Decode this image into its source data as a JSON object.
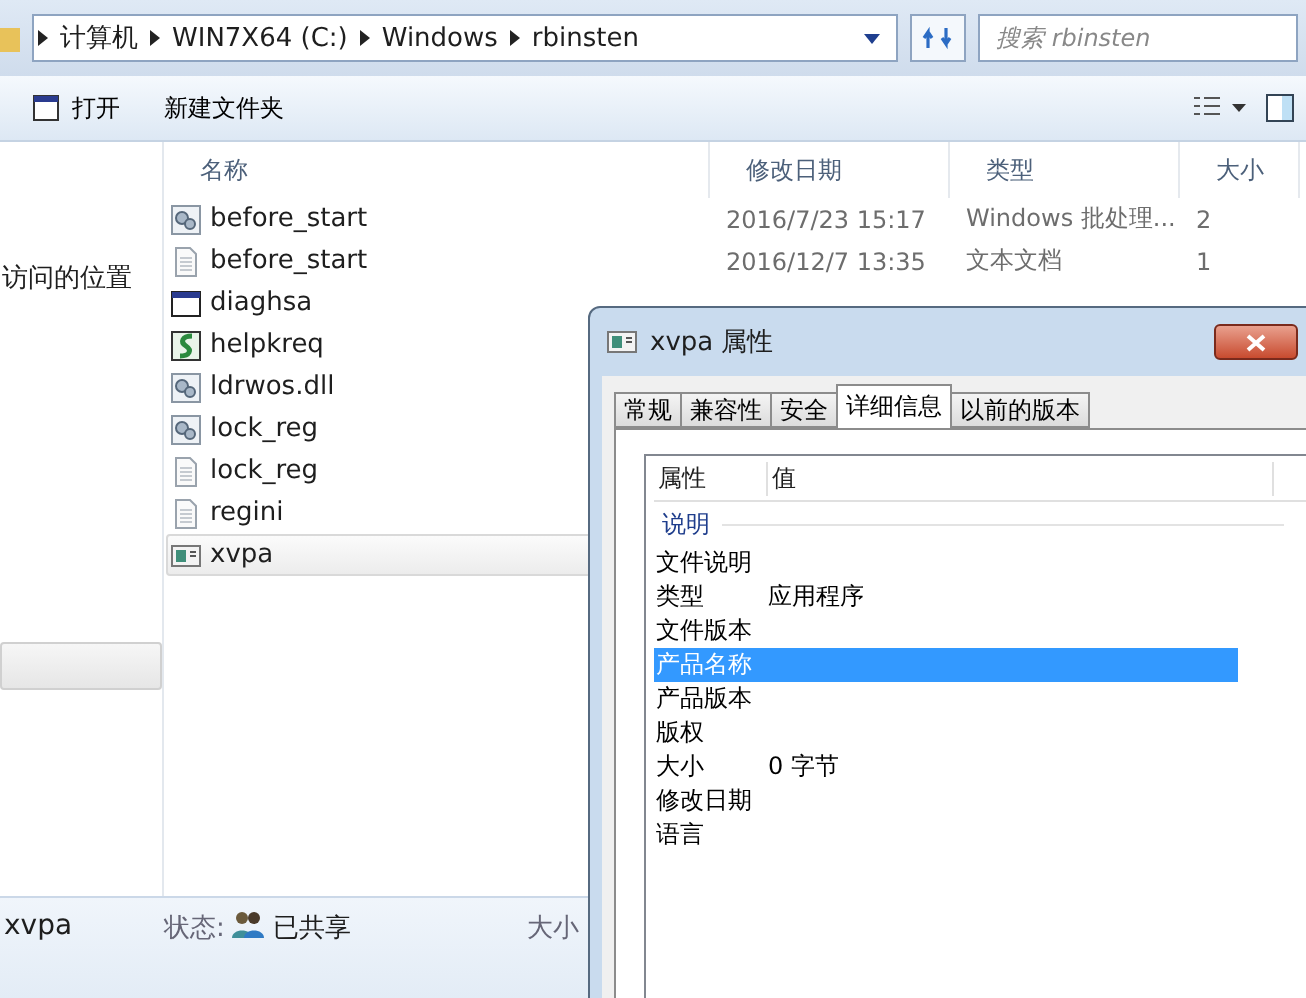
{
  "address_bar": {
    "crumbs": [
      "计算机",
      "WIN7X64 (C:)",
      "Windows",
      "rbinsten"
    ]
  },
  "search": {
    "placeholder": "搜索 rbinsten"
  },
  "toolbar": {
    "buttons": [
      "打开",
      "新建文件夹"
    ]
  },
  "sidebar": {
    "items": [
      {
        "label": "访问的位置",
        "selected": false
      },
      {
        "selected": true
      }
    ]
  },
  "file_list": {
    "columns": [
      "名称",
      "修改日期",
      "类型",
      "大小"
    ],
    "rows": [
      {
        "name": "before_start",
        "kind": "gear",
        "date": "2016/7/23 15:17",
        "type": "Windows 批处理...",
        "size": "2",
        "selected": false
      },
      {
        "name": "before_start",
        "kind": "text",
        "date": "2016/12/7 13:35",
        "type": "文本文档",
        "size": "1",
        "selected": false
      },
      {
        "name": "diaghsa",
        "kind": "window",
        "selected": false
      },
      {
        "name": "helpkreq",
        "kind": "script",
        "selected": false
      },
      {
        "name": "ldrwos.dll",
        "kind": "gear",
        "selected": false
      },
      {
        "name": "lock_reg",
        "kind": "gear",
        "selected": false
      },
      {
        "name": "lock_reg",
        "kind": "text",
        "selected": false
      },
      {
        "name": "regini",
        "kind": "text",
        "selected": false
      },
      {
        "name": "xvpa",
        "kind": "app",
        "selected": true
      }
    ]
  },
  "details_pane": {
    "name": "xvpa",
    "status_label": "状态:",
    "status_value": "已共享",
    "size_label": "大小"
  },
  "dialog": {
    "title": "xvpa 属性",
    "tabs": [
      {
        "label": "常规",
        "selected": false
      },
      {
        "label": "兼容性",
        "selected": false
      },
      {
        "label": "安全",
        "selected": false
      },
      {
        "label": "详细信息",
        "selected": true
      },
      {
        "label": "以前的版本",
        "selected": false
      }
    ],
    "columns": [
      "属性",
      "值"
    ],
    "section": "说明",
    "properties": [
      {
        "name": "文件说明",
        "selected": false
      },
      {
        "name": "类型",
        "value": "应用程序",
        "selected": false
      },
      {
        "name": "文件版本",
        "selected": false
      },
      {
        "name": "产品名称",
        "selected": true
      },
      {
        "name": "产品版本",
        "selected": false
      },
      {
        "name": "版权",
        "selected": false
      },
      {
        "name": "大小",
        "value": "0 字节",
        "selected": false
      },
      {
        "name": "修改日期",
        "selected": false
      },
      {
        "name": "语言",
        "selected": false
      }
    ]
  }
}
